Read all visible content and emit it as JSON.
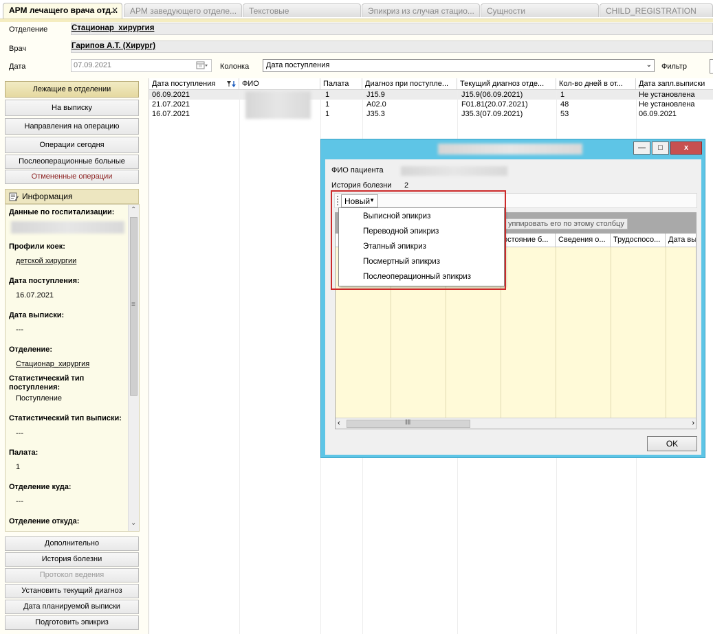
{
  "tabs": [
    {
      "label": "АРМ лечащего врача отд...",
      "active": true,
      "close": "✕"
    },
    {
      "label": "АРМ заведующего отделе...",
      "active": false
    },
    {
      "label": "Текстовые",
      "active": false
    },
    {
      "label": "Эпикриз из случая стацио...",
      "active": false
    },
    {
      "label": "Сущности",
      "active": false
    },
    {
      "label": "CHILD_REGISTRATION",
      "active": false
    }
  ],
  "header": {
    "department_label": "Отделение",
    "department_value": "Стационар_хирургия",
    "doctor_label": "Врач",
    "doctor_value": "Гарипов А.Т. (Хирург)",
    "date_label": "Дата",
    "date_value": "07.09.2021",
    "column_label": "Колонка",
    "column_value": "Дата поступления",
    "filter_label": "Фильтр"
  },
  "nav": {
    "top": [
      {
        "label": "Лежащие в отделении",
        "state": "selected"
      },
      {
        "label": "На выписку",
        "state": "normal"
      },
      {
        "label": "Направления на операцию",
        "state": "normal"
      },
      {
        "label": "Операции сегодня",
        "state": "normal"
      },
      {
        "label": "Послеоперационные больные",
        "state": "normal"
      },
      {
        "label": "Отмененные операции",
        "state": "red"
      }
    ],
    "bottom": [
      {
        "label": "Дополнительно",
        "state": "normal"
      },
      {
        "label": "История болезни",
        "state": "normal"
      },
      {
        "label": "Протокол ведения",
        "state": "disabled"
      },
      {
        "label": "Установить текущий диагноз",
        "state": "normal"
      },
      {
        "label": "Дата планируемой выписки",
        "state": "normal"
      },
      {
        "label": "Подготовить эпикриз",
        "state": "normal"
      }
    ]
  },
  "info": {
    "title": "Информация",
    "hosp_label": "Данные по госпитализации:",
    "bed_label": "Профили коек:",
    "bed_value": "детской хирургии",
    "adm_label": "Дата поступления:",
    "adm_value": "16.07.2021",
    "dis_label": "Дата выписки:",
    "dis_value": "---",
    "dept_label": "Отделение:",
    "dept_value": "Стационар_хирургия",
    "stat_in_label": "Статистический тип поступления:",
    "stat_in_value": "Поступление",
    "stat_out_label": "Статистический тип выписки:",
    "stat_out_value": "---",
    "ward_label": "Палата:",
    "ward_value": "1",
    "to_label": "Отделение куда:",
    "to_value": "---",
    "from_label": "Отделение откуда:"
  },
  "grid": {
    "columns": [
      "Дата поступления",
      "ФИО",
      "Палата",
      "Диагноз при поступле...",
      "Текущий диагноз отде...",
      "Кол-во дней в от...",
      "Дата запл.выписки"
    ],
    "rows": [
      [
        "06.09.2021",
        "",
        "1",
        "J15.9",
        "J15.9(06.09.2021)",
        "1",
        "Не установлена"
      ],
      [
        "21.07.2021",
        "",
        "1",
        "A02.0",
        "F01.81(20.07.2021)",
        "48",
        "Не установлена"
      ],
      [
        "16.07.2021",
        "",
        "1",
        "J35.3",
        "J35.3(07.09.2021)",
        "53",
        "06.09.2021"
      ]
    ]
  },
  "dialog": {
    "patient_label": "ФИО пациента",
    "history_label": "История болезни",
    "history_value": "2",
    "new_button": "Новый",
    "group_hint": "уппировать его по этому столбцу",
    "columns": [
      "остояние б...",
      "Сведения о...",
      "Трудоспосо...",
      "Дата вы"
    ],
    "menu": [
      "Выписной эпикриз",
      "Переводной эпикриз",
      "Этапный эпикриз",
      "Посмертный эпикриз",
      "Послеоперационный эпикриз"
    ],
    "ok": "OK",
    "minimize": "—",
    "maximize": "□",
    "close": "x"
  }
}
